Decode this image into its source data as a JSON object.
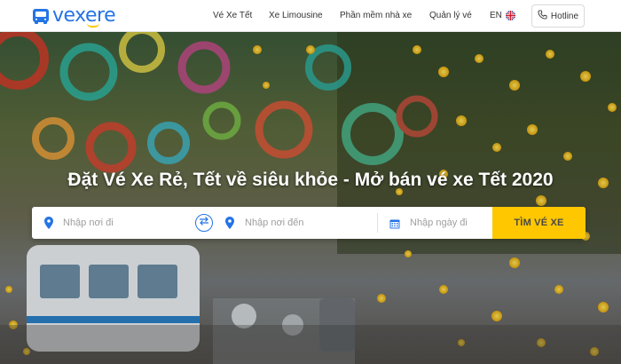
{
  "brand": {
    "name": "vexere",
    "color": "#2474e5",
    "accent": "#ffc700"
  },
  "nav": {
    "items": [
      {
        "label": "Vé Xe Tết"
      },
      {
        "label": "Xe Limousine"
      },
      {
        "label": "Phần mềm nhà xe"
      },
      {
        "label": "Quản lý vé"
      }
    ],
    "language": "EN",
    "hotline_label": "Hotline"
  },
  "hero": {
    "headline": "Đặt Vé Xe Rẻ, Tết về siêu khỏe - Mở bán vé xe Tết 2020"
  },
  "search": {
    "from_placeholder": "Nhập nơi đi",
    "to_placeholder": "Nhập nơi đến",
    "date_placeholder": "Nhập ngày đi",
    "button_label": "TÌM VÉ XE"
  },
  "icons": {
    "logo": "bus-icon",
    "language_flag": "uk-flag-icon",
    "hotline": "phone-icon",
    "from": "location-pin-icon",
    "swap": "swap-icon",
    "to": "location-pin-icon",
    "date": "calendar-icon"
  }
}
